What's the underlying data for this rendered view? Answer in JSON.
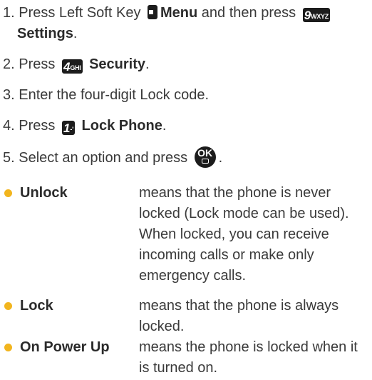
{
  "steps": [
    {
      "num": "1.",
      "pre": "Press Left Soft Key",
      "b1": "Menu",
      "mid": "and then press",
      "key2_num": "9",
      "key2_letters": "WXYZ",
      "b2": "Settings",
      "end": "."
    },
    {
      "num": "2.",
      "pre": "Press",
      "key_num": "4",
      "key_letters": "GHI",
      "bold": "Security",
      "end": "."
    },
    {
      "num": "3.",
      "text": "Enter the four-digit Lock code."
    },
    {
      "num": "4.",
      "pre": "Press",
      "key_num": "1",
      "key_letters": "-'",
      "bold": "Lock Phone",
      "end": "."
    },
    {
      "num": "5.",
      "pre": "Select an option and press",
      "ok_label": "OK",
      "end": "."
    }
  ],
  "options": [
    {
      "term": "Unlock",
      "lines": [
        "means that the phone is never",
        "locked (Lock mode can be used).",
        "When locked, you can receive",
        "incoming calls or make only",
        "emergency calls."
      ]
    },
    {
      "term": "Lock",
      "lines": [
        "means that the phone is always",
        "locked."
      ]
    },
    {
      "term": "On Power Up",
      "lines": [
        "means the phone is locked when it",
        "is turned on."
      ]
    }
  ],
  "colors": {
    "bullet": "#f2b51e",
    "key_bg": "#1c1c1c",
    "text": "#3a3a3a"
  }
}
